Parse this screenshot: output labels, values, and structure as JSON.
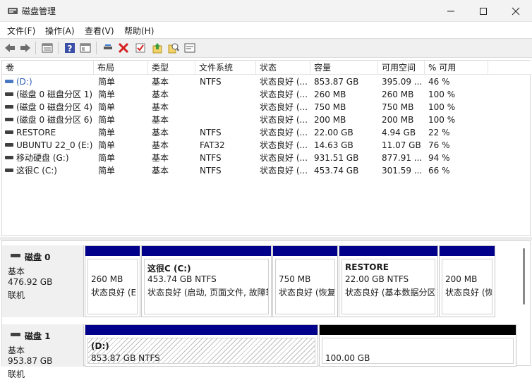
{
  "window": {
    "title": "磁盘管理"
  },
  "menu": [
    "文件(F)",
    "操作(A)",
    "查看(V)",
    "帮助(H)"
  ],
  "toolbar_icons": [
    "back-arrow-icon",
    "forward-arrow-icon",
    "properties-icon",
    "help-icon",
    "view-icon",
    "connect-icon",
    "delete-icon",
    "check-icon",
    "up-icon",
    "search-icon",
    "console-icon"
  ],
  "columns": [
    "卷",
    "布局",
    "类型",
    "文件系统",
    "状态",
    "容量",
    "可用空间",
    "% 可用"
  ],
  "volumes": [
    {
      "name": "(D:)",
      "layout": "简单",
      "type": "基本",
      "fs": "NTFS",
      "status": "状态良好 (...",
      "capacity": "853.87 GB",
      "free": "395.09 ...",
      "pct": "46 %",
      "selected": true
    },
    {
      "name": "(磁盘 0 磁盘分区 1)",
      "layout": "简单",
      "type": "基本",
      "fs": "",
      "status": "状态良好 (...",
      "capacity": "260 MB",
      "free": "260 MB",
      "pct": "100 %",
      "selected": false
    },
    {
      "name": "(磁盘 0 磁盘分区 4)",
      "layout": "简单",
      "type": "基本",
      "fs": "",
      "status": "状态良好 (...",
      "capacity": "750 MB",
      "free": "750 MB",
      "pct": "100 %",
      "selected": false
    },
    {
      "name": "(磁盘 0 磁盘分区 6)",
      "layout": "简单",
      "type": "基本",
      "fs": "",
      "status": "状态良好 (...",
      "capacity": "200 MB",
      "free": "200 MB",
      "pct": "100 %",
      "selected": false
    },
    {
      "name": "RESTORE",
      "layout": "简单",
      "type": "基本",
      "fs": "NTFS",
      "status": "状态良好 (...",
      "capacity": "22.00 GB",
      "free": "4.94 GB",
      "pct": "22 %",
      "selected": false
    },
    {
      "name": "UBUNTU 22_0 (E:)",
      "layout": "简单",
      "type": "基本",
      "fs": "FAT32",
      "status": "状态良好 (...",
      "capacity": "14.63 GB",
      "free": "11.07 GB",
      "pct": "76 %",
      "selected": false
    },
    {
      "name": "移动硬盘 (G:)",
      "layout": "简单",
      "type": "基本",
      "fs": "NTFS",
      "status": "状态良好 (...",
      "capacity": "931.51 GB",
      "free": "877.91 ...",
      "pct": "94 %",
      "selected": false
    },
    {
      "name": "这很C (C:)",
      "layout": "简单",
      "type": "基本",
      "fs": "NTFS",
      "status": "状态良好 (...",
      "capacity": "453.74 GB",
      "free": "301.59 ...",
      "pct": "66 %",
      "selected": false
    }
  ],
  "disks": [
    {
      "name": "磁盘 0",
      "type": "基本",
      "size": "476.92 GB",
      "state": "联机",
      "partitions": [
        {
          "title": "",
          "size": "260 MB",
          "status": "状态良好 (E"
        },
        {
          "title": "这很C  (C:)",
          "size": "453.74 GB NTFS",
          "status": "状态良好 (启动, 页面文件, 故障转"
        },
        {
          "title": "",
          "size": "750 MB",
          "status": "状态良好 (恢复"
        },
        {
          "title": "RESTORE",
          "size": "22.00 GB NTFS",
          "status": "状态良好 (基本数据分区"
        },
        {
          "title": "",
          "size": "200 MB",
          "status": "状态良好 (恢"
        }
      ]
    },
    {
      "name": "磁盘 1",
      "type": "基本",
      "size": "953.87 GB",
      "state": "联机",
      "partitions": [
        {
          "title": "(D:)",
          "size": "853.87 GB NTFS",
          "status": ""
        },
        {
          "title": "",
          "size": "100.00 GB",
          "status": ""
        }
      ]
    }
  ],
  "colors": {
    "primary_bar": "#00008b",
    "unallocated_bar": "#000000",
    "selected_icon": "#4a78c2"
  }
}
